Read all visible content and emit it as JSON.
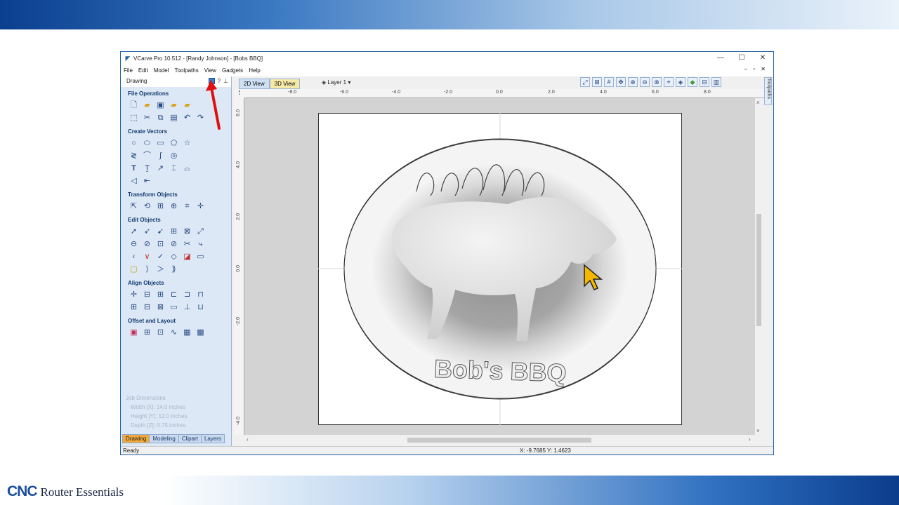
{
  "app": {
    "title": "VCarve Pro 10.512 - [Randy Johnson] - [Bobs BBQ]",
    "window_controls": [
      "—",
      "☐",
      "✕"
    ]
  },
  "menu": [
    "File",
    "Edit",
    "Model",
    "Toolpaths",
    "View",
    "Gadgets",
    "Help"
  ],
  "panel": {
    "title": "Drawing",
    "sections": [
      {
        "label": "File Operations",
        "rows": [
          [
            "new-file",
            "open-file",
            "save-file",
            "import-file",
            "open-folder"
          ],
          [
            "select-all",
            "cut",
            "copy",
            "paste",
            "undo",
            "redo"
          ]
        ]
      },
      {
        "label": "Create Vectors",
        "rows": [
          [
            "circle",
            "ellipse",
            "rectangle",
            "polygon",
            "star"
          ],
          [
            "polyline",
            "arc",
            "curve",
            "spiral"
          ],
          [
            "text",
            "text-frame",
            "text-on-curve",
            "dimension",
            "text-arc"
          ],
          [
            "draw-tool",
            "ruler"
          ]
        ]
      },
      {
        "label": "Transform Objects",
        "rows": [
          [
            "move",
            "rotate",
            "mirror",
            "scale",
            "distort",
            "center"
          ]
        ]
      },
      {
        "label": "Edit Objects",
        "rows": [
          [
            "select",
            "node-edit",
            "select-by",
            "group",
            "ungroup",
            "trim"
          ],
          [
            "weld",
            "subtract",
            "intersect",
            "divide",
            "scissors",
            "fillet"
          ],
          [
            "close",
            "join",
            "smooth",
            "curve-fit",
            "mark",
            "offset"
          ],
          [
            "boundary",
            "bracket-left",
            "chevron",
            "bracket-right"
          ]
        ]
      },
      {
        "label": "Align Objects",
        "rows": [
          [
            "align-center",
            "align-h",
            "align-v",
            "align-left",
            "align-right",
            "align-top"
          ],
          [
            "align-grid",
            "distribute-h",
            "distribute-v",
            "space",
            "align-bottom",
            "stack"
          ]
        ]
      },
      {
        "label": "Offset and Layout",
        "rows": [
          [
            "offset",
            "array",
            "nest",
            "copy-along",
            "grid-array",
            "nest-parts"
          ]
        ]
      }
    ],
    "job_dimensions": {
      "title": "Job Dimensions",
      "width": "Width  [X]: 14.0 inches",
      "height": "Height [Y]: 12.0 inches",
      "depth": "Depth  [Z]: 0.75 inches"
    },
    "tabs": [
      "Drawing",
      "Modeling",
      "Clipart",
      "Layers"
    ]
  },
  "view": {
    "tab_2d": "2D View",
    "tab_3d": "3D View",
    "layer": "Layer 1",
    "toolpaths_tab": "Toolpaths"
  },
  "rulers": {
    "top": [
      "-8.0",
      "-6.0",
      "-4.0",
      "-2.0",
      "0.0",
      "2.0",
      "4.0",
      "6.0",
      "8.0"
    ],
    "left": [
      "6.0",
      "4.0",
      "2.0",
      "0.0",
      "-2.0",
      "-4.0"
    ]
  },
  "artwork": {
    "text": "Bob's BBQ"
  },
  "status": {
    "ready": "Ready",
    "coords": "X: -9.7685 Y:  1.4623"
  },
  "branding": {
    "cnc": "CNC",
    "rest": "Router Essentials"
  },
  "colors": {
    "accent": "#1f5faa",
    "arrow": "#e01010",
    "cursor": "#f5b800"
  }
}
